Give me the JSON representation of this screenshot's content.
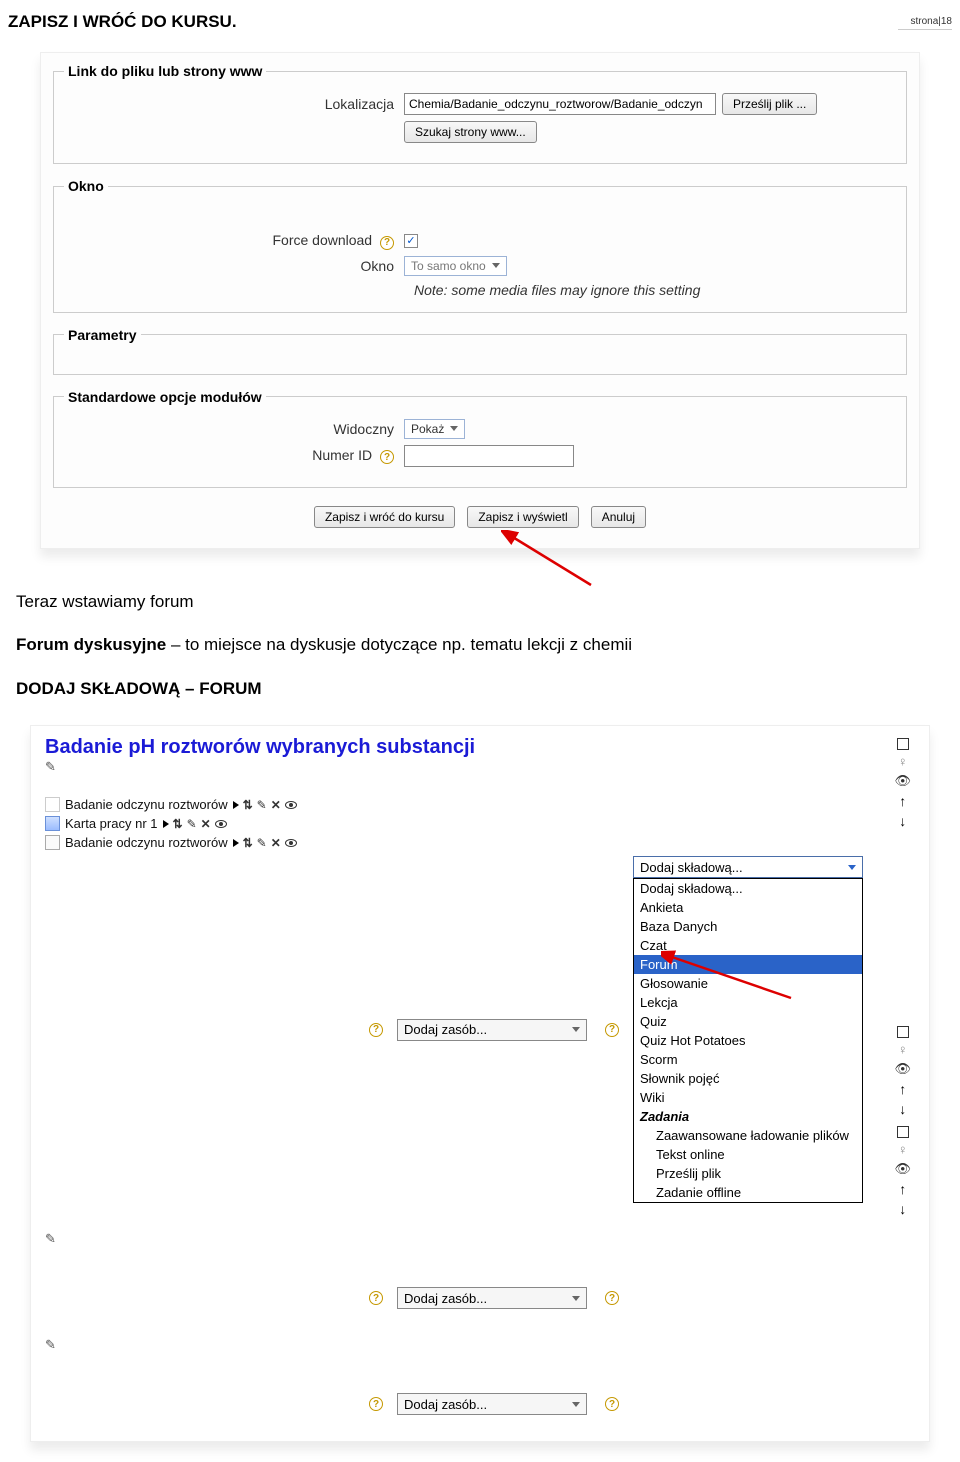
{
  "pageTitle": "ZAPISZ I WRÓĆ DO KURSU.",
  "pageMarker": "strona|18",
  "screenshot1": {
    "fieldset1": {
      "legend": "Link do pliku lub strony www",
      "label1": "Lokalizacja",
      "locValue": "Chemia/Badanie_odczynu_roztworow/Badanie_odczyn",
      "uploadBtn": "Prześlij plik ...",
      "searchBtn": "Szukaj strony www..."
    },
    "fieldset2": {
      "legend": "Okno",
      "forceLabel": "Force download",
      "oknoLabel": "Okno",
      "oknoSelected": "To samo okno",
      "note": "Note: some media files may ignore this setting"
    },
    "fieldset3": {
      "legend": "Parametry"
    },
    "fieldset4": {
      "legend": "Standardowe opcje modułów",
      "visibleLabel": "Widoczny",
      "visibleSelected": "Pokaż",
      "numerLabel": "Numer ID"
    },
    "submit": {
      "save": "Zapisz i wróć do kursu",
      "saveShow": "Zapisz i wyświetl",
      "cancel": "Anuluj"
    },
    "checkmark": "✓"
  },
  "middleText": {
    "line1": "Teraz wstawiamy forum",
    "line2a": "Forum dyskusyjne",
    "line2b": " – to miejsce na dyskusje dotyczące np. tematu lekcji z chemii",
    "line3": "DODAJ SKŁADOWĄ – FORUM"
  },
  "screenshot2": {
    "title": "Badanie pH roztworów wybranych substancji",
    "res1": "Badanie odczynu roztworów",
    "res2": "Karta pracy nr 1",
    "res3": "Badanie odczynu roztworów",
    "addResource": "Dodaj zasób...",
    "addComponent": "Dodaj składową...",
    "dd": {
      "header": "Dodaj składową...",
      "items": [
        "Ankieta",
        "Baza Danych",
        "Czat",
        "Forum",
        "Głosowanie",
        "Lekcja",
        "Quiz",
        "Quiz Hot Potatoes",
        "Scorm",
        "Słownik pojęć",
        "Wiki"
      ],
      "groupHeader": "Zadania",
      "subItems": [
        "Zaawansowane ładowanie plików",
        "Tekst online",
        "Prześlij plik",
        "Zadanie offline"
      ]
    },
    "iconLabels": {
      "right": "→",
      "updown": "⇅",
      "pencil": "✎",
      "x": "✕"
    }
  }
}
